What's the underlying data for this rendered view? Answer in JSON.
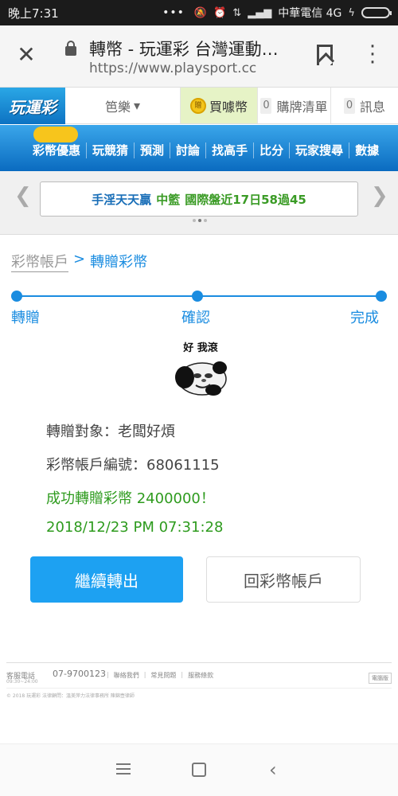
{
  "status_bar": {
    "time": "晚上7:31",
    "carrier": "中華電信 4G"
  },
  "browser": {
    "page_title": "轉幣 - 玩運彩 台灣運動…",
    "url": "https://www.playsport.cc"
  },
  "site_header": {
    "logo_text": "玩運彩",
    "user_name": "笆樂",
    "buy_label": "買噱幣",
    "cart_count": "0",
    "cart_label": "購牌清單",
    "msg_count": "0",
    "msg_label": "訊息"
  },
  "nav": {
    "items": [
      "彩幣優惠",
      "玩競猜",
      "預測",
      "討論",
      "找高手",
      "比分",
      "玩家搜尋",
      "數據"
    ]
  },
  "banner": {
    "part1": "手淫天天贏",
    "part2": "中籃",
    "part3": "國際盤近17日58過45"
  },
  "breadcrumb": {
    "parent": "彩幣帳戶",
    "separator": ">",
    "current": "轉贈彩幣"
  },
  "steps": [
    "轉贈",
    "確認",
    "完成"
  ],
  "meme": {
    "caption": "好 我滾"
  },
  "details": {
    "recipient": "轉贈對象：老闆好煩",
    "account": "彩幣帳戶編號：68061115",
    "success": "成功轉贈彩幣 2400000！",
    "timestamp": "2018/12/23 PM 07:31:28"
  },
  "buttons": {
    "continue": "繼續轉出",
    "back_account": "回彩幣帳戶"
  },
  "footer": {
    "service_label": "客服電話",
    "hours": "09:30~24:00",
    "phone": "07-9700123",
    "links": [
      "聯絡我們",
      "常見問題",
      "服務條款"
    ],
    "mobile": "電腦版",
    "copyright": "© 2018 玩運彩 法律顧問：溫美萍力法律事務所 陳錦壺律師"
  },
  "colors": {
    "accent": "#1a8ce0",
    "success": "#2e9b1e",
    "primary_button": "#1da1f2"
  }
}
